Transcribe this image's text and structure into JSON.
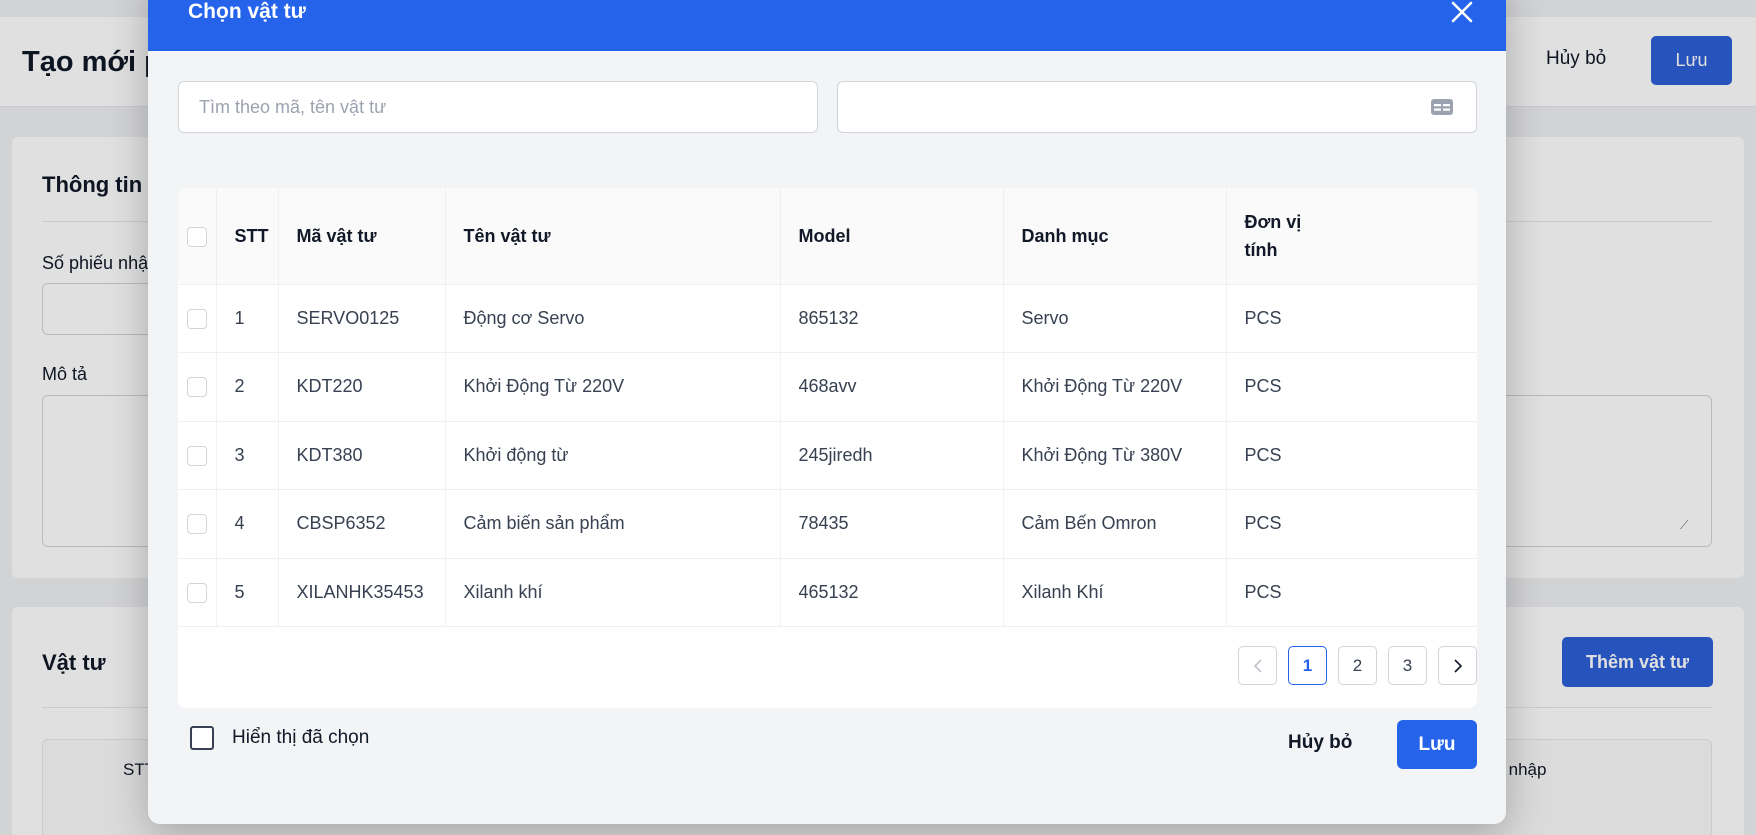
{
  "background": {
    "page_title": "Tạo mới p",
    "header_cancel": "Hủy bỏ",
    "header_save": "Lưu",
    "info_section_title": "Thông tin",
    "receipt_number_label": "Số phiếu nhậ",
    "description_label": "Mô tả",
    "materials_section_title": "Vật tư",
    "add_material_button": "Thêm vật tư",
    "table_header_stt": "STT",
    "table_header_qty": "ng nhập"
  },
  "modal": {
    "title": "Chọn vật tư",
    "search_placeholder": "Tìm theo mã, tên vật tư",
    "category_value": "",
    "columns": [
      "STT",
      "Mã vật tư",
      "Tên vật tư",
      "Model",
      "Danh mục",
      "Đơn vị tính"
    ],
    "rows": [
      {
        "stt": "1",
        "code": "SERVO0125",
        "name": "Động cơ Servo",
        "model": "865132",
        "category": "Servo",
        "unit": "PCS"
      },
      {
        "stt": "2",
        "code": "KDT220",
        "name": "Khởi Động Từ 220V",
        "model": "468avv",
        "category": "Khởi Động Từ 220V",
        "unit": "PCS"
      },
      {
        "stt": "3",
        "code": "KDT380",
        "name": "Khởi động từ",
        "model": "245jiredh",
        "category": "Khởi Động Từ 380V",
        "unit": "PCS"
      },
      {
        "stt": "4",
        "code": "CBSP6352",
        "name": "Cảm biến sản phẩm",
        "model": "78435",
        "category": "Cảm Bến Omron",
        "unit": "PCS"
      },
      {
        "stt": "5",
        "code": "XILANHK35453",
        "name": "Xilanh khí",
        "model": "465132",
        "category": "Xilanh Khí",
        "unit": "PCS"
      }
    ],
    "pagination": {
      "prev": "‹",
      "pages": [
        "1",
        "2",
        "3"
      ],
      "next": "›",
      "current": "1"
    },
    "show_selected_label": "Hiển thị đã chọn",
    "cancel_label": "Hủy bỏ",
    "save_label": "Lưu"
  }
}
